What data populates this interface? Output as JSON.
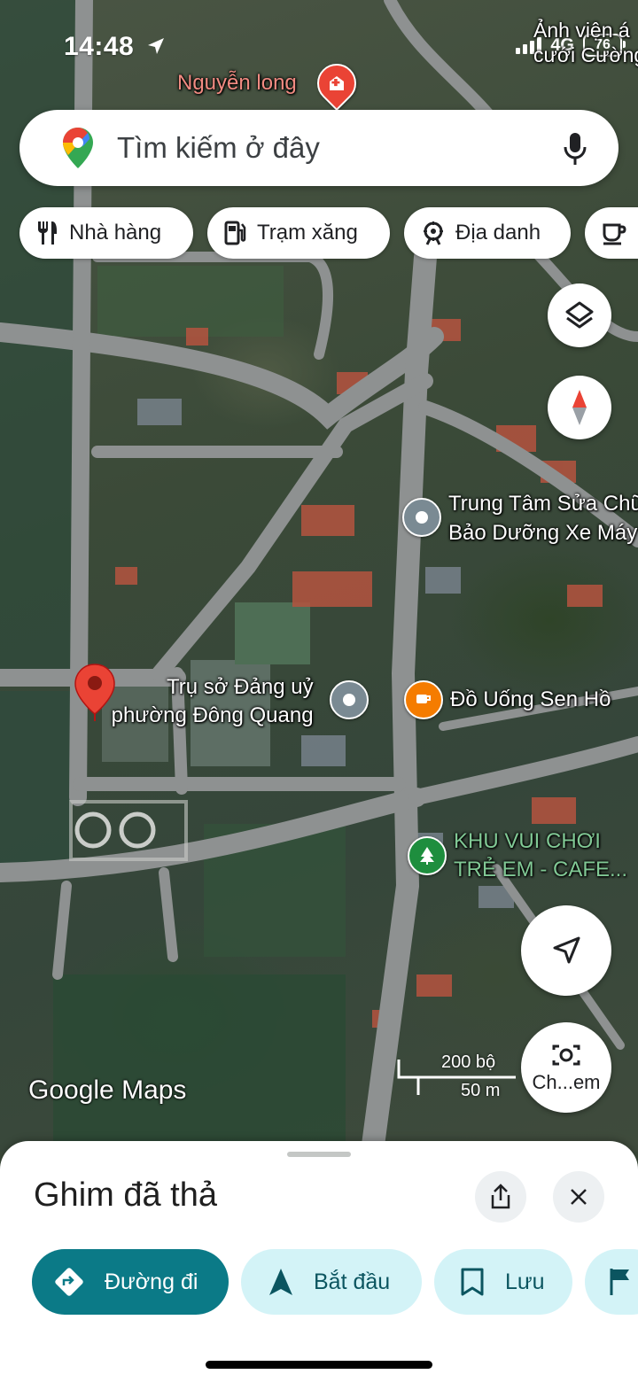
{
  "status_bar": {
    "time": "14:48",
    "network": "4G",
    "battery": "76"
  },
  "search": {
    "placeholder": "Tìm kiếm ở đây"
  },
  "chips": [
    {
      "label": "Nhà hàng",
      "icon": "restaurant-icon"
    },
    {
      "label": "Trạm xăng",
      "icon": "gas-station-icon"
    },
    {
      "label": "Địa danh",
      "icon": "landmark-icon"
    },
    {
      "label": "",
      "icon": "coffee-icon"
    }
  ],
  "map": {
    "labels": {
      "hospital": "Nguyễn long",
      "photo_studio_line1": "Ảnh viện á",
      "photo_studio_line2": "cưới Cường",
      "repair_line1": "Trung Tâm Sửa Chữ",
      "repair_line2": "Bảo Dưỡng Xe Máy",
      "party_hq_line1": "Trụ sở Đảng uỷ",
      "party_hq_line2": "phường Đông Quang",
      "drinks": "Đồ Uống Sen Hồ",
      "playground_line1": "KHU VUI CHƠI",
      "playground_line2": "TRẺ EM - CAFE..."
    },
    "watermark": "Google Maps",
    "scale_imperial": "200 bộ",
    "scale_metric": "50 m",
    "camera_label": "Ch...em"
  },
  "sheet": {
    "title": "Ghim đã thả",
    "actions": [
      {
        "label": "Đường đi",
        "icon": "directions-icon"
      },
      {
        "label": "Bắt đầu",
        "icon": "navigation-arrow-icon"
      },
      {
        "label": "Lưu",
        "icon": "bookmark-icon"
      },
      {
        "label": "",
        "icon": "flag-icon"
      }
    ]
  },
  "colors": {
    "primary_teal": "#0b7a87",
    "secondary_teal": "#d3f3f7",
    "pin_red": "#ea4335"
  }
}
